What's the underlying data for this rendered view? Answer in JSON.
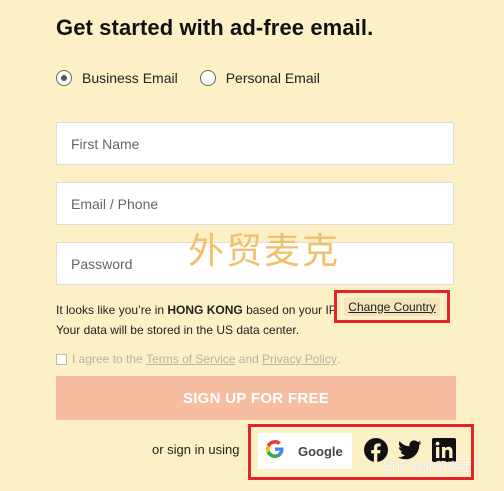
{
  "title": "Get started with ad-free email.",
  "account_type": {
    "options": [
      {
        "label": "Business Email",
        "selected": true
      },
      {
        "label": "Personal Email",
        "selected": false
      }
    ]
  },
  "form": {
    "first_name_placeholder": "First Name",
    "email_placeholder": "Email / Phone",
    "password_placeholder": "Password"
  },
  "watermark": "外贸麦克",
  "location_notice": {
    "prefix": "It looks like you’re in",
    "country": "HONG KONG",
    "suffix": "based on your IP",
    "change_country_label": "Change Country",
    "data_center": "Your data will be stored in the US data center."
  },
  "terms": {
    "prefix": "I agree to the",
    "tos_label": "Terms of Service",
    "and": "and",
    "privacy_label": "Privacy Policy",
    "end": "."
  },
  "signup_button_label": "SIGN UP FOR FREE",
  "social": {
    "or_text": "or sign in using",
    "google_label": "Google",
    "icons": [
      "google-icon",
      "facebook-icon",
      "twitter-icon",
      "linkedin-icon"
    ]
  },
  "zhihu_watermark": "知乎 @外贸麦克",
  "colors": {
    "background": "#fdf0c6",
    "signup_button": "#f6bda0",
    "highlight_box": "#e0262a"
  }
}
